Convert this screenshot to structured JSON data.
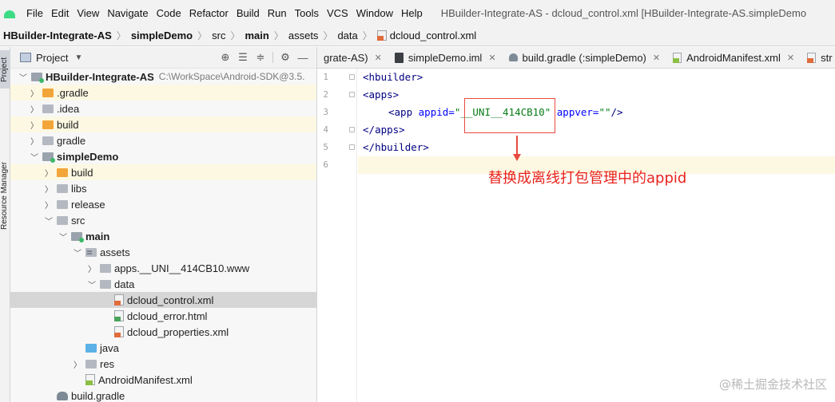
{
  "menubar": {
    "items": [
      "File",
      "Edit",
      "View",
      "Navigate",
      "Code",
      "Refactor",
      "Build",
      "Run",
      "Tools",
      "VCS",
      "Window",
      "Help"
    ],
    "window_title": "HBuilder-Integrate-AS - dcloud_control.xml [HBuilder-Integrate-AS.simpleDemo"
  },
  "breadcrumb": [
    "HBuilder-Integrate-AS",
    "simpleDemo",
    "src",
    "main",
    "assets",
    "data",
    "dcloud_control.xml"
  ],
  "tool_strip": {
    "project": "Project",
    "resource_manager": "Resource Manager"
  },
  "project_panel": {
    "title": "Project",
    "tree": [
      {
        "label": "HBuilder-Integrate-AS",
        "path": "C:\\WorkSpace\\Android-SDK@3.5.",
        "bold": true,
        "icon": "folder-module"
      },
      {
        "label": ".gradle",
        "icon": "folder-orange"
      },
      {
        "label": ".idea",
        "icon": "folder"
      },
      {
        "label": "build",
        "icon": "folder-orange"
      },
      {
        "label": "gradle",
        "icon": "folder"
      },
      {
        "label": "simpleDemo",
        "bold": true,
        "icon": "folder-module"
      },
      {
        "label": "build",
        "icon": "folder-orange"
      },
      {
        "label": "libs",
        "icon": "folder"
      },
      {
        "label": "release",
        "icon": "folder"
      },
      {
        "label": "src",
        "icon": "folder"
      },
      {
        "label": "main",
        "bold": true,
        "icon": "folder-module"
      },
      {
        "label": "assets",
        "icon": "folder-assets"
      },
      {
        "label": "apps.__UNI__414CB10.www",
        "icon": "folder"
      },
      {
        "label": "data",
        "icon": "folder"
      },
      {
        "label": "dcloud_control.xml",
        "icon": "xml-file"
      },
      {
        "label": "dcloud_error.html",
        "icon": "html-file"
      },
      {
        "label": "dcloud_properties.xml",
        "icon": "xml-file"
      },
      {
        "label": "java",
        "icon": "folder-blue"
      },
      {
        "label": "res",
        "icon": "folder"
      },
      {
        "label": "AndroidManifest.xml",
        "icon": "manifest-file"
      },
      {
        "label": "build.gradle",
        "icon": "gradle-file"
      }
    ]
  },
  "editor_tabs": [
    {
      "label": "grate-AS)"
    },
    {
      "label": "simpleDemo.iml"
    },
    {
      "label": "build.gradle (:simpleDemo)"
    },
    {
      "label": "AndroidManifest.xml"
    },
    {
      "label": "str"
    }
  ],
  "editor": {
    "line_numbers": [
      "1",
      "2",
      "3",
      "4",
      "5",
      "6"
    ],
    "line1": {
      "open": "<",
      "tag": "hbuilder",
      "close": ">"
    },
    "line2": {
      "open": "<",
      "tag": "apps",
      "close": ">"
    },
    "line3": {
      "open": "<",
      "tag": "app",
      "attr1": "appid",
      "eq1": "=",
      "val1": "\"__UNI__414CB10\"",
      "attr2": "appver",
      "eq2": "=",
      "val2": "\"\"",
      "close": "/>"
    },
    "line4": {
      "open": "</",
      "tag": "apps",
      "close": ">"
    },
    "line5": {
      "open": "</",
      "tag": "hbuilder",
      "close": ">"
    }
  },
  "annotation": {
    "text": "替换成离线打包管理中的appid",
    "color": "#e8231b"
  },
  "watermark": "@稀土掘金技术社区",
  "colors": {
    "accent_red": "#e84a3f",
    "highlight_line": "#fdf8e2",
    "selected_row": "#d6d6d6"
  }
}
